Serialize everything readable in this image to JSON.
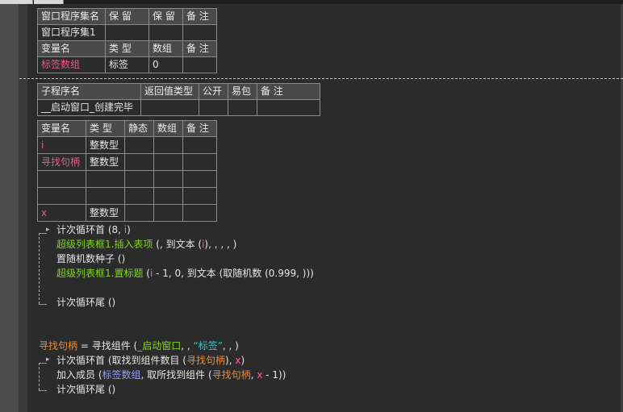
{
  "assembly_table": {
    "headers": [
      "窗口程序集名",
      "保 留",
      "保 留",
      "备 注"
    ],
    "row": [
      "窗口程序集1",
      "",
      "",
      ""
    ]
  },
  "assembly_var_table": {
    "headers": [
      "变量名",
      "类 型",
      "数组",
      "备 注"
    ],
    "row": [
      "标签数组",
      "标签",
      "0",
      ""
    ]
  },
  "sub_table": {
    "headers": [
      "子程序名",
      "返回值类型",
      "公开",
      "易包",
      "备 注"
    ],
    "row": [
      "__启动窗口_创建完毕",
      "",
      "",
      "",
      ""
    ]
  },
  "local_var_table": {
    "headers": [
      "变量名",
      "类 型",
      "静态",
      "数组",
      "备 注"
    ],
    "rows": [
      [
        "i",
        "整数型",
        "",
        "",
        ""
      ],
      [
        "寻找句柄",
        "整数型",
        "",
        "",
        ""
      ],
      [
        "",
        "",
        "",
        "",
        ""
      ],
      [
        "",
        "",
        "",
        "",
        ""
      ],
      [
        "x",
        "整数型",
        "",
        "",
        ""
      ]
    ]
  },
  "code": {
    "l1_a": "计次循环首 (8, ",
    "l1_b": "i",
    "l1_c": ")",
    "l2_a": "超级列表框1.插入表项",
    "l2_b": " (, 到文本 (",
    "l2_c": "i",
    "l2_d": "), , , , )",
    "l3": "置随机数种子 ()",
    "l4_a": "超级列表框1.置标题",
    "l4_b": " (",
    "l4_c": "i",
    "l4_d": " - 1, 0, 到文本 (取随机数 (0.999, )))",
    "l5": "计次循环尾 ()",
    "l6_a": "寻找句柄",
    "l6_b": " = 寻找组件 (",
    "l6_c": "_启动窗口",
    "l6_d": ", , ",
    "l6_e": "“标签”",
    "l6_f": ", , )",
    "l7_a": "计次循环首 (取找到组件数目 (",
    "l7_b": "寻找句柄",
    "l7_c": "), ",
    "l7_d": "x",
    "l7_e": ")",
    "l8_a": "加入成员 (",
    "l8_b": "标签数组",
    "l8_c": ", 取所找到组件 (",
    "l8_d": "寻找句柄",
    "l8_e": ", ",
    "l8_f": "x",
    "l8_g": " - 1))",
    "l9": "计次循环尾 ()"
  }
}
